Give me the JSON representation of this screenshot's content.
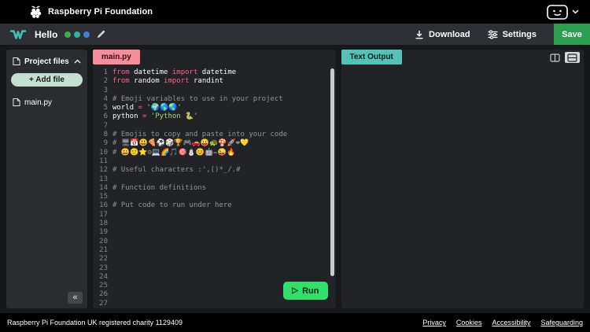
{
  "topbar": {
    "brand": "Raspberry Pi Foundation"
  },
  "project": {
    "title": "Hello",
    "title_emojis": "🌍🌎🌏",
    "download_label": "Download",
    "settings_label": "Settings",
    "save_label": "Save"
  },
  "sidebar": {
    "title": "Project files",
    "add_file_label": "+ Add file",
    "files": [
      "main.py"
    ],
    "collapse_glyph": "«"
  },
  "editor": {
    "tab_label": "main.py",
    "run_label": "Run",
    "run_icon": "▷",
    "lines": [
      {
        "seg": [
          [
            "kw",
            "from"
          ],
          [
            "pl",
            " datetime "
          ],
          [
            "kw",
            "import"
          ],
          [
            "pl",
            " datetime"
          ]
        ]
      },
      {
        "seg": [
          [
            "kw",
            "from"
          ],
          [
            "pl",
            " random "
          ],
          [
            "kw",
            "import"
          ],
          [
            "pl",
            " randint"
          ]
        ]
      },
      {
        "seg": []
      },
      {
        "seg": [
          [
            "com",
            "# Emoji variables to use in your project"
          ]
        ]
      },
      {
        "seg": [
          [
            "pl",
            "world "
          ],
          [
            "op",
            "= "
          ],
          [
            "str",
            "'🌍🌎🌏'"
          ]
        ]
      },
      {
        "seg": [
          [
            "pl",
            "python "
          ],
          [
            "op",
            "= "
          ],
          [
            "str",
            "'Python 🐍'"
          ]
        ]
      },
      {
        "seg": []
      },
      {
        "seg": [
          [
            "com",
            "# Emojis to copy and paste into your code"
          ]
        ]
      },
      {
        "seg": [
          [
            "com",
            "# 🖥📅😃🍕⚽🎲🏆🎮🚗😛🐢🍄🚀❤💛"
          ]
        ]
      },
      {
        "seg": [
          [
            "com",
            "# 😀🙂⭐⚙💻🌈🎵🎯⛄😊🤖✏😜🔥"
          ]
        ]
      },
      {
        "seg": []
      },
      {
        "seg": [
          [
            "com",
            "# Useful characters :',()*_/.#"
          ]
        ]
      },
      {
        "seg": []
      },
      {
        "seg": [
          [
            "com",
            "# Function definitions"
          ]
        ]
      },
      {
        "seg": []
      },
      {
        "seg": [
          [
            "com",
            "# Put code to run under here"
          ]
        ]
      },
      {
        "seg": []
      },
      {
        "seg": []
      },
      {
        "seg": []
      },
      {
        "seg": []
      },
      {
        "seg": []
      },
      {
        "seg": []
      },
      {
        "seg": []
      },
      {
        "seg": []
      },
      {
        "seg": []
      },
      {
        "seg": []
      },
      {
        "seg": []
      }
    ]
  },
  "output": {
    "tab_label": "Text Output"
  },
  "footer": {
    "charity": "Raspberry Pi Foundation UK registered charity 1129409",
    "links": [
      "Privacy",
      "Cookies",
      "Accessibility",
      "Safeguarding"
    ]
  },
  "colors": {
    "accent-teal": "#3ec1b3",
    "save-green": "#2b9e50",
    "run-green": "#30df6c",
    "add-file-mint": "#c3e1d3",
    "tab-editor": "#f68d98",
    "tab-output": "#53c3b9",
    "globe-1": "#3fae49",
    "globe-2": "#2ab5a0",
    "globe-3": "#3f7fd6",
    "syntax": {
      "keyword": "#ff6188",
      "string": "#a9dc76",
      "comment": "#939293",
      "operator": "#ff6188",
      "plain": "#fcfcfa"
    }
  }
}
